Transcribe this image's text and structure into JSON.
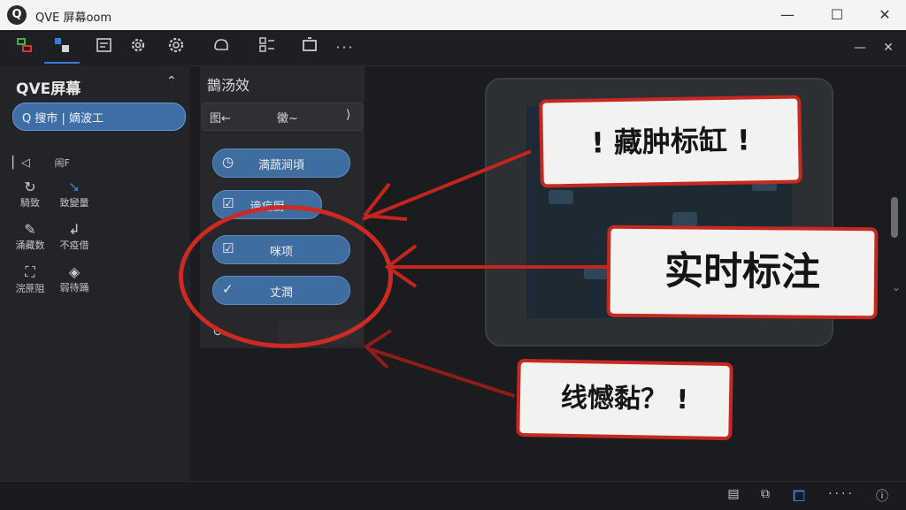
{
  "window": {
    "logo": "Q",
    "title": "QVE 屏幕oom",
    "minimize": "—",
    "maximize": "☐",
    "close": "✕"
  },
  "toolbar": {
    "icons": [
      "layers-icon",
      "select-icon",
      "checklist-icon",
      "gear-icon",
      "settings-icon",
      "chat-icon",
      "grid-icon",
      "frame-icon",
      "more-icon"
    ],
    "right_minimize": "—",
    "right_close": "✕"
  },
  "left_panel": {
    "title": "QVE屏幕",
    "search_label": "Q 搜市 | 嫡波工",
    "tools": [
      {
        "label": "闹F"
      },
      {
        "label": "騎致"
      },
      {
        "label": "致變量"
      },
      {
        "label": "涌藏数"
      },
      {
        "label": "不疫借"
      },
      {
        "label": "浣蔗阻"
      },
      {
        "label": "弱待踊"
      }
    ]
  },
  "mid_panel": {
    "title": "鵲汤效",
    "bar_left": "图←",
    "bar_mid": "黴~",
    "bar_right": "⟩",
    "pills": [
      {
        "icon": "◷",
        "label": "満蔬涧頃"
      },
      {
        "icon": "☑",
        "label": "谛疟厨"
      },
      {
        "icon": "☑",
        "label": "咪项"
      },
      {
        "icon": "✓",
        "label": "丈潤"
      }
    ],
    "footer_icon": "↻"
  },
  "annotations": {
    "note_top": "! 藏肿标缸 !",
    "note_middle": "实时标注",
    "note_bottom": "线憾黏？ !"
  },
  "statusbar": {
    "icons": [
      "message-icon",
      "copy-icon",
      "window-icon",
      "dots-icon",
      "info-icon"
    ]
  },
  "colors": {
    "accent": "#3f6ea6",
    "annotation_red": "#c7281f"
  }
}
